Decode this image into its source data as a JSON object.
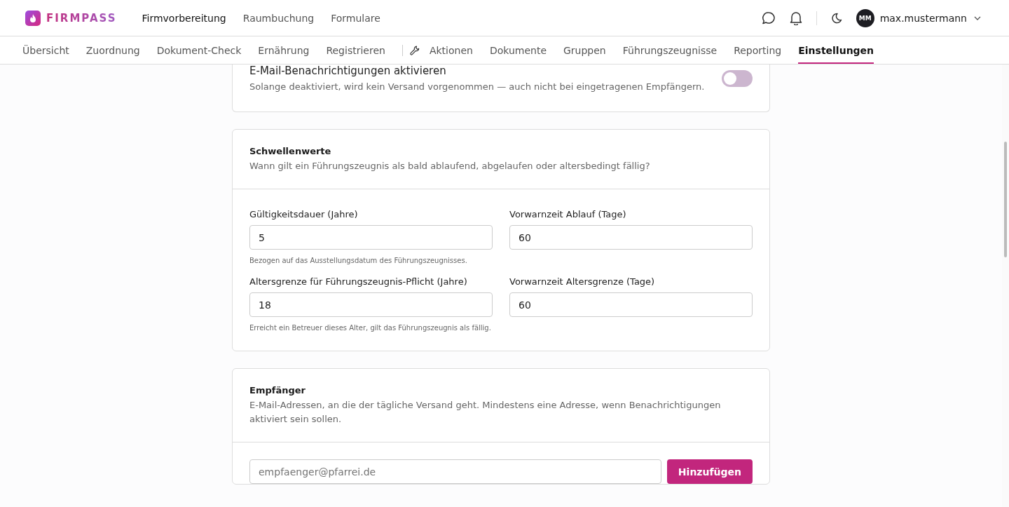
{
  "header": {
    "brand": "FIRMPASS",
    "nav": [
      {
        "label": "Firmvorbereitung",
        "selected": true
      },
      {
        "label": "Raumbuchung",
        "selected": false
      },
      {
        "label": "Formulare",
        "selected": false
      }
    ],
    "user": {
      "initials": "MM",
      "name": "max.mustermann"
    }
  },
  "subnav": {
    "groups": [
      {
        "items": [
          {
            "label": "Übersicht",
            "selected": false
          },
          {
            "label": "Zuordnung",
            "selected": false
          },
          {
            "label": "Dokument-Check",
            "selected": false
          },
          {
            "label": "Ernährung",
            "selected": false
          },
          {
            "label": "Registrieren",
            "selected": false
          }
        ]
      },
      {
        "items": [
          {
            "label": "Aktionen",
            "selected": false
          },
          {
            "label": "Dokumente",
            "selected": false
          },
          {
            "label": "Gruppen",
            "selected": false
          },
          {
            "label": "Führungszeugnisse",
            "selected": false
          },
          {
            "label": "Reporting",
            "selected": false
          },
          {
            "label": "Einstellungen",
            "selected": true
          }
        ]
      }
    ]
  },
  "notifications": {
    "title": "E-Mail-Benachrichtigungen aktivieren",
    "description": "Solange deaktiviert, wird kein Versand vorgenommen — auch nicht bei eingetragenen Empfängern.",
    "on": false
  },
  "thresholds": {
    "title": "Schwellenwerte",
    "description": "Wann gilt ein Führungszeugnis als bald ablaufend, abgelaufen oder altersbedingt fällig?",
    "fields": [
      {
        "label": "Gültigkeitsdauer (Jahre)",
        "value": "5",
        "hint": "Bezogen auf das Ausstellungsdatum des Führungszeugnisses."
      },
      {
        "label": "Vorwarnzeit Ablauf (Tage)",
        "value": "60"
      },
      {
        "label": "Altersgrenze für Führungszeugnis-Pflicht (Jahre)",
        "value": "18",
        "hint": "Erreicht ein Betreuer dieses Alter, gilt das Führungszeugnis als fällig."
      },
      {
        "label": "Vorwarnzeit Altersgrenze (Tage)",
        "value": "60"
      }
    ]
  },
  "recipients": {
    "title": "Empfänger",
    "description": "E-Mail-Adressen, an die der tägliche Versand geht. Mindestens eine Adresse, wenn Benachrichtigungen aktiviert sein sollen.",
    "placeholder": "empfaenger@pfarrei.de",
    "button": "Hinzufügen"
  }
}
